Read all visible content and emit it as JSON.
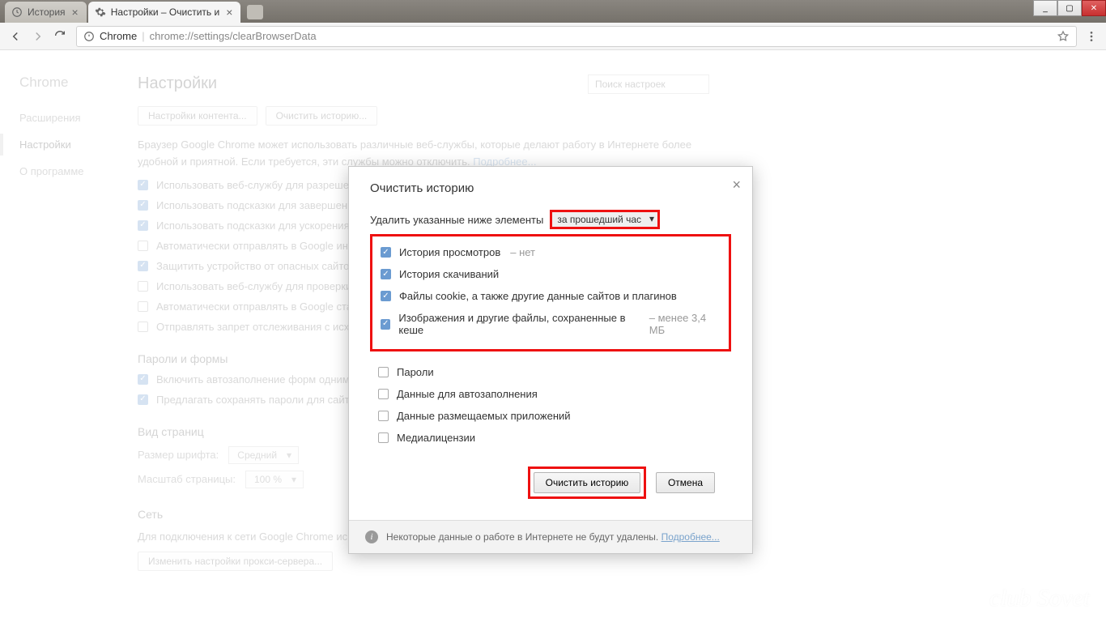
{
  "window": {
    "minimize": "_",
    "maximize": "▢",
    "close": "✕"
  },
  "tabs": [
    {
      "title": "История",
      "active": false,
      "icon": "history"
    },
    {
      "title": "Настройки – Очистить и",
      "active": true,
      "icon": "gear"
    }
  ],
  "addr": {
    "origin": "Chrome",
    "url": "chrome://settings/clearBrowserData"
  },
  "sidebar": {
    "brand": "Chrome",
    "items": [
      "Расширения",
      "Настройки",
      "О программе"
    ],
    "active_index": 1
  },
  "page": {
    "title": "Настройки",
    "search_placeholder": "Поиск настроек",
    "buttons": [
      "Настройки контента...",
      "Очистить историю..."
    ],
    "help": "Браузер Google Chrome может использовать различные веб-службы, которые делают работу в Интернете более удобной и приятной. Если требуется, эти службы можно отключить.",
    "help_link": "Подробнее...",
    "privacyChecks": [
      {
        "checked": true,
        "label": "Использовать веб-службу для разрешения"
      },
      {
        "checked": true,
        "label": "Использовать подсказки для завершения"
      },
      {
        "checked": true,
        "label": "Использовать подсказки для ускорения за"
      },
      {
        "checked": false,
        "label": "Автоматически отправлять в Google инфор"
      },
      {
        "checked": true,
        "label": "Защитить устройство от опасных сайтов"
      },
      {
        "checked": false,
        "label": "Использовать веб-службу для проверки пр"
      },
      {
        "checked": false,
        "label": "Автоматически отправлять в Google стати"
      },
      {
        "checked": false,
        "label": "Отправлять запрет отслеживания с исходя"
      }
    ],
    "pw_heading": "Пароли и формы",
    "pwChecks": [
      {
        "checked": true,
        "label": "Включить автозаполнение форм одним кл"
      },
      {
        "checked": true,
        "label": "Предлагать сохранять пароли для сайтов Н"
      }
    ],
    "view_heading": "Вид страниц",
    "font_label": "Размер шрифта:",
    "font_value": "Средний",
    "zoom_label": "Масштаб страницы:",
    "zoom_value": "100 %",
    "net_heading": "Сеть",
    "net_text": "Для подключения к сети Google Chrome использует системные настройки прокси-сервера.",
    "net_btn": "Изменить настройки прокси-сервера..."
  },
  "modal": {
    "title": "Очистить историю",
    "range_label": "Удалить указанные ниже элементы",
    "range_value": "за прошедший час",
    "opts": [
      {
        "checked": true,
        "label": "История просмотров",
        "meta": "– нет"
      },
      {
        "checked": true,
        "label": "История скачиваний",
        "meta": ""
      },
      {
        "checked": true,
        "label": "Файлы cookie, а также другие данные сайтов и плагинов",
        "meta": ""
      },
      {
        "checked": true,
        "label": "Изображения и другие файлы, сохраненные в кеше",
        "meta": "– менее 3,4 МБ"
      },
      {
        "checked": false,
        "label": "Пароли",
        "meta": ""
      },
      {
        "checked": false,
        "label": "Данные для автозаполнения",
        "meta": ""
      },
      {
        "checked": false,
        "label": "Данные размещаемых приложений",
        "meta": ""
      },
      {
        "checked": false,
        "label": "Медиалицензии",
        "meta": ""
      }
    ],
    "clear_btn": "Очистить историю",
    "cancel_btn": "Отмена",
    "info_text": "Некоторые данные о работе в Интернете не будут удалены.",
    "info_link": "Подробнее..."
  },
  "watermark": "club Sovet"
}
